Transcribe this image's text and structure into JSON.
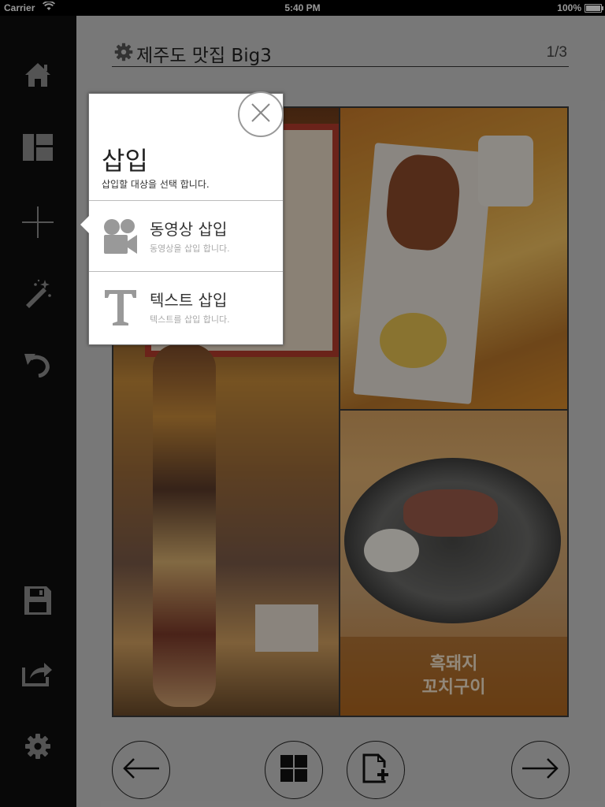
{
  "status_bar": {
    "carrier": "Carrier",
    "time": "5:40 PM",
    "battery": "100%"
  },
  "sidebar": {
    "items": [
      {
        "name": "home",
        "icon": "home-icon"
      },
      {
        "name": "layout",
        "icon": "layout-icon"
      },
      {
        "name": "insert",
        "icon": "plus-icon"
      },
      {
        "name": "effects",
        "icon": "magic-wand-icon"
      },
      {
        "name": "undo",
        "icon": "undo-icon"
      },
      {
        "name": "save",
        "icon": "save-icon"
      },
      {
        "name": "share",
        "icon": "share-icon"
      },
      {
        "name": "settings",
        "icon": "gear-icon"
      }
    ]
  },
  "header": {
    "title": "제주도 맛집 Big3",
    "page": "1/3"
  },
  "content": {
    "caption_line1": "흑돼지",
    "caption_line2": "꼬치구이"
  },
  "popover": {
    "title": "삽입",
    "subtitle": "삽입할 대상을 선택 합니다.",
    "items": [
      {
        "label": "동영상 삽입",
        "desc": "동영상을 삽입 합니다.",
        "icon": "video-camera-icon"
      },
      {
        "label": "텍스트 삽입",
        "desc": "텍스트를 삽입 합니다.",
        "icon": "text-icon"
      }
    ]
  },
  "bottom_nav": {
    "buttons": [
      "arrow-left-icon",
      "grid-icon",
      "add-page-icon",
      "arrow-right-icon"
    ]
  },
  "colors": {
    "sidebar_bg": "#0e0e0e",
    "main_bg": "#c9c9c9",
    "popover_bg": "#ffffff"
  }
}
